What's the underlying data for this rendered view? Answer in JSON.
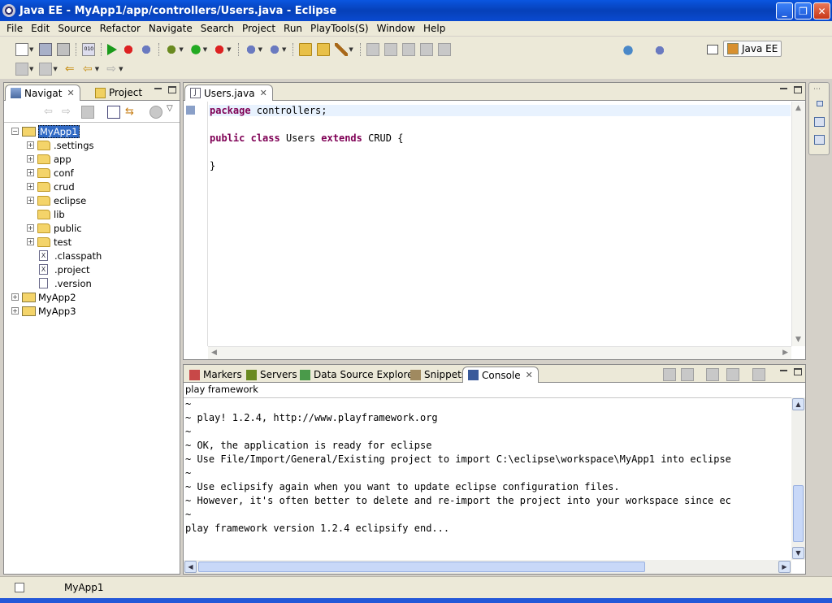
{
  "window": {
    "title": "Java EE - MyApp1/app/controllers/Users.java - Eclipse"
  },
  "menu": [
    "File",
    "Edit",
    "Source",
    "Refactor",
    "Navigate",
    "Search",
    "Project",
    "Run",
    "PlayTools(S)",
    "Window",
    "Help"
  ],
  "perspective": {
    "label": "Java EE"
  },
  "navigator": {
    "tabs": [
      {
        "label": "Navigat",
        "active": true
      },
      {
        "label": "Project",
        "active": false
      }
    ],
    "tree": [
      {
        "label": "MyApp1",
        "type": "project",
        "depth": 0,
        "expander": "-",
        "selected": true
      },
      {
        "label": ".settings",
        "type": "folder",
        "depth": 1,
        "expander": "+"
      },
      {
        "label": "app",
        "type": "folder",
        "depth": 1,
        "expander": "+"
      },
      {
        "label": "conf",
        "type": "folder",
        "depth": 1,
        "expander": "+"
      },
      {
        "label": "crud",
        "type": "folder",
        "depth": 1,
        "expander": "+"
      },
      {
        "label": "eclipse",
        "type": "folder",
        "depth": 1,
        "expander": "+"
      },
      {
        "label": "lib",
        "type": "folder",
        "depth": 1,
        "expander": ""
      },
      {
        "label": "public",
        "type": "folder",
        "depth": 1,
        "expander": "+"
      },
      {
        "label": "test",
        "type": "folder",
        "depth": 1,
        "expander": "+"
      },
      {
        "label": ".classpath",
        "type": "xfile",
        "depth": 1,
        "expander": ""
      },
      {
        "label": ".project",
        "type": "xfile",
        "depth": 1,
        "expander": ""
      },
      {
        "label": ".version",
        "type": "file",
        "depth": 1,
        "expander": ""
      },
      {
        "label": "MyApp2",
        "type": "project",
        "depth": 0,
        "expander": "+"
      },
      {
        "label": "MyApp3",
        "type": "project",
        "depth": 0,
        "expander": "+"
      }
    ]
  },
  "editor": {
    "tab": {
      "label": "Users.java"
    },
    "lines": [
      [
        {
          "t": "package",
          "kw": true
        },
        {
          "t": " controllers;"
        }
      ],
      [],
      [
        {
          "t": "public",
          "kw": true
        },
        {
          "t": " "
        },
        {
          "t": "class",
          "kw": true
        },
        {
          "t": " Users "
        },
        {
          "t": "extends",
          "kw": true
        },
        {
          "t": " CRUD {"
        }
      ],
      [],
      [
        {
          "t": "}"
        }
      ]
    ]
  },
  "bottom": {
    "tabs": [
      {
        "label": "Markers",
        "active": false
      },
      {
        "label": "Servers",
        "active": false
      },
      {
        "label": "Data Source Explorer",
        "active": false
      },
      {
        "label": "Snippets",
        "active": false
      },
      {
        "label": "Console",
        "active": true
      }
    ],
    "console_name": "play framework",
    "console_lines": [
      "~",
      "~ play! 1.2.4, http://www.playframework.org",
      "~",
      "~ OK, the application is ready for eclipse",
      "~ Use File/Import/General/Existing project to import C:\\eclipse\\workspace\\MyApp1 into eclipse",
      "~",
      "~ Use eclipsify again when you want to update eclipse configuration files.",
      "~ However, it's often better to delete and re-import the project into your workspace since ec",
      "~",
      "play framework version 1.2.4 eclipsify end..."
    ]
  },
  "status": {
    "selection": "MyApp1"
  },
  "colors": {
    "titlebar": "#0a4ad0",
    "keyword": "#7f0055",
    "selection": "#316ac5"
  }
}
